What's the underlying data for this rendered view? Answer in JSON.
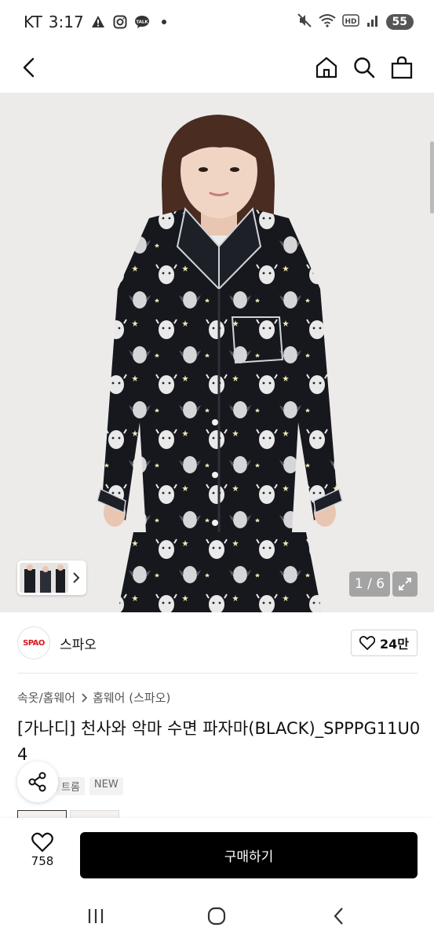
{
  "status_bar": {
    "carrier": "KT",
    "time": "3:17",
    "battery": "55",
    "icons": [
      "warning-icon",
      "instagram-icon",
      "kakaotalk-icon",
      "dot-icon",
      "mute-icon",
      "wifi-icon",
      "hd-icon",
      "signal-icon",
      "battery-icon"
    ]
  },
  "top_nav": {
    "icons": [
      "back-arrow-icon",
      "home-icon",
      "search-icon",
      "shopping-bag-icon"
    ]
  },
  "gallery": {
    "counter": "1 / 6",
    "thumb_icon": "chevron-right-icon",
    "expand_icon": "expand-icon"
  },
  "brand": {
    "logo_text": "SPAO",
    "name": "스파오",
    "like_count": "24만"
  },
  "breadcrumb": {
    "category": "속옷/홈웨어",
    "subcategory": "홈웨어 (스파오)"
  },
  "product": {
    "title": "[가나디] 천사와 악마 수면 파자마(BLACK)_SPPPG11U04",
    "tags": [
      "트롬",
      "NEW"
    ]
  },
  "bottom_bar": {
    "wish_count": "758",
    "buy_label": "구매하기"
  },
  "colors": {
    "brand_red": "#d71920",
    "buy_button": "#000000",
    "hero_bg": "#ecebea",
    "pajama": "#16181d"
  }
}
